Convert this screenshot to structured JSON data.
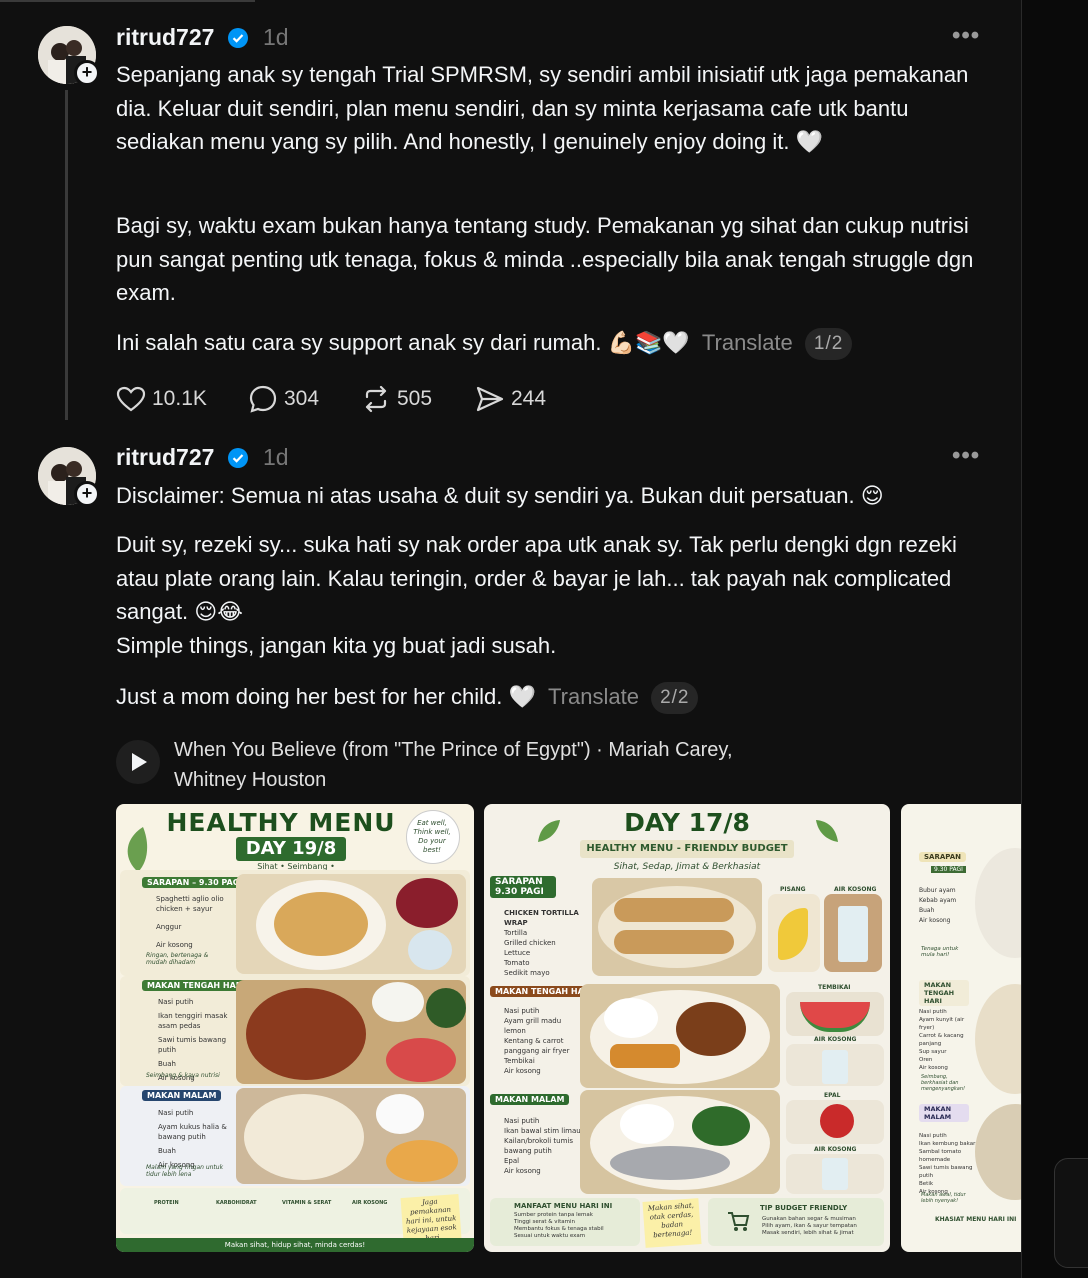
{
  "posts": [
    {
      "username": "ritrud727",
      "time": "1d",
      "paragraphs": [
        "Sepanjang anak sy tengah Trial SPMRSM, sy sendiri ambil inisiatif utk jaga pemakanan dia. Keluar duit sendiri, plan menu sendiri, dan sy minta kerjasama cafe utk bantu sediakan menu yang sy pilih. And honestly, I genuinely enjoy doing it. 🤍",
        "Bagi sy, waktu exam bukan hanya tentang study. Pemakanan yg sihat dan cukup nutrisi pun sangat penting utk tenaga, fokus & minda ..especially bila anak tengah struggle dgn exam.",
        "Ini salah satu cara sy support anak sy dari rumah. 💪🏻📚🤍"
      ],
      "translate": "Translate",
      "page": "1/2",
      "stats": {
        "likes": "10.1K",
        "comments": "304",
        "reposts": "505",
        "shares": "244"
      }
    },
    {
      "username": "ritrud727",
      "time": "1d",
      "paragraphs": [
        "Disclaimer: Semua ni atas usaha & duit sy sendiri ya. Bukan duit persatuan. 😌",
        "Duit sy, rezeki sy... suka hati sy nak order apa utk anak sy. Tak perlu dengki dgn rezeki atau plate orang lain. Kalau teringin, order & bayar je lah... tak payah nak complicated sangat. 😌😂",
        "Simple things, jangan kita yg buat jadi susah.",
        "Just a mom doing her best for her child. 🤍"
      ],
      "translate": "Translate",
      "page": "2/2",
      "music": "When You Believe (from \"The Prince of Egypt\") · Mariah Carey, Whitney Houston"
    }
  ],
  "images": [
    {
      "title": "HEALTHY MENU",
      "day": "DAY 19/8",
      "tagline": "Sihat • Seimbang • Berkhasiat",
      "note": "Eat well, Think well, Do your best!",
      "sections": [
        {
          "label": "SARAPAN – 9.30 PAGI",
          "items": [
            "Spaghetti aglio olio chicken + sayur",
            "Anggur",
            "Air kosong"
          ],
          "caption": "Ringan, bertenaga & mudah dihadam"
        },
        {
          "label": "MAKAN TENGAH HARI",
          "items": [
            "Nasi putih",
            "Ikan tenggiri masak asam pedas",
            "Sawi tumis bawang putih",
            "Buah",
            "Air kosong"
          ],
          "caption": "Seimbang & kaya nutrisi"
        },
        {
          "label": "MAKAN MALAM",
          "items": [
            "Nasi putih",
            "Ayam kukus halia & bawang putih",
            "Buah",
            "Air kosong"
          ],
          "caption": "Malam yang ringan untuk tidur lebih lena"
        }
      ],
      "benefits": [
        "PROTEIN",
        "KARBOHIDRAT",
        "VITAMIN & SERAT",
        "AIR KOSONG"
      ],
      "sticky": "Jaga pemakanan hari ini, untuk kejayaan esok hari",
      "footer": "Makan sihat, hidup sihat, minda cerdas!"
    },
    {
      "title": "DAY 17/8",
      "subtitle": "HEALTHY MENU - FRIENDLY BUDGET",
      "tagline": "Sihat, Sedap, Jimat & Berkhasiat",
      "sections": [
        {
          "label": "SARAPAN 9.30 PAGI",
          "items": [
            "CHICKEN TORTILLA WRAP",
            "Tortilla",
            "Grilled chicken",
            "Lettuce",
            "Tomato",
            "Sedikit mayo"
          ],
          "extras": [
            "PISANG",
            "AIR KOSONG"
          ]
        },
        {
          "label": "MAKAN TENGAH HARI",
          "items": [
            "Nasi putih",
            "Ayam grill madu lemon",
            "Kentang & carrot panggang air fryer",
            "Tembikai",
            "Air kosong"
          ],
          "extras": [
            "TEMBIKAI",
            "AIR KOSONG"
          ]
        },
        {
          "label": "MAKAN MALAM",
          "items": [
            "Nasi putih",
            "Ikan bawal stim limau",
            "Kailan/brokoli tumis bawang putih",
            "Epal",
            "Air kosong"
          ],
          "extras": [
            "EPAL",
            "AIR KOSONG"
          ]
        }
      ],
      "benefits_title": "MANFAAT MENU HARI INI",
      "benefits": [
        "Sumber protein tanpa lemak",
        "Tinggi serat & vitamin",
        "Membantu fokus & tenaga stabil",
        "Sesuai untuk waktu exam"
      ],
      "sticky": "Makan sihat, otak cerdas, badan bertenaga!",
      "tips_title": "TIP BUDGET FRIENDLY",
      "tips": [
        "Gunakan bahan segar & musiman",
        "Pilih ayam, ikan & sayur tempatan",
        "Masak sendiri, lebih sihat & jimat"
      ]
    },
    {
      "sections": [
        {
          "label": "SARAPAN",
          "time": "9.30 PAGI",
          "items": [
            "Bubur ayam",
            "Kebab ayam",
            "Buah",
            "Air kosong"
          ],
          "caption": "Tenaga untuk mula hari!"
        },
        {
          "label": "MAKAN TENGAH HARI",
          "items": [
            "Nasi putih",
            "Ayam kunyit (air fryer)",
            "Carrot & kacang panjang",
            "Sup sayur",
            "Oren",
            "Air kosong"
          ],
          "caption": "Seimbang, berkhasiat dan mengenyangkan!"
        },
        {
          "label": "MAKAN MALAM",
          "items": [
            "Nasi putih",
            "Ikan kembung bakar",
            "Sambal tomato homemade",
            "Sawi tumis bawang putih",
            "Betik",
            "Air kosong"
          ],
          "caption": "Makan awal, tidur lebih nyenyak!"
        }
      ],
      "footer_title": "KHASIAT MENU HARI INI"
    }
  ],
  "colors": {
    "bg": "#101010",
    "text": "#f3f5f7",
    "muted": "#777777",
    "verified": "#0095f6",
    "menu_green": "#2e6b2e"
  }
}
